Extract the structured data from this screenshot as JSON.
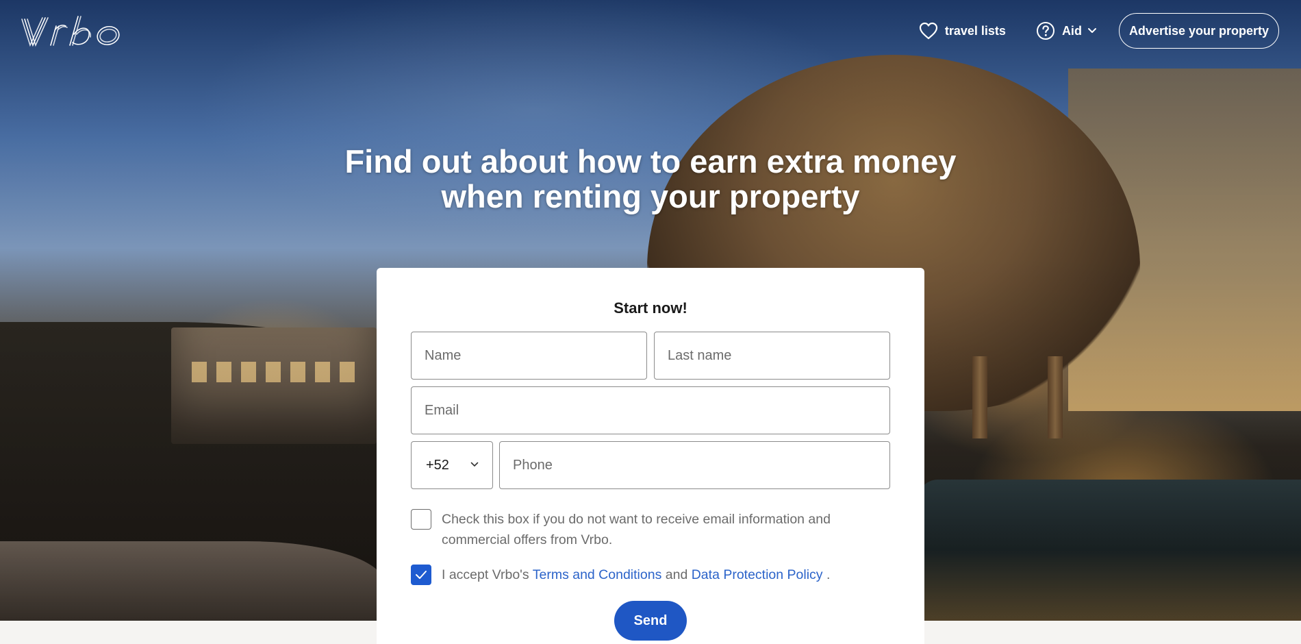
{
  "header": {
    "logo_text": "Vrbo",
    "travel_lists_label": "travel lists",
    "aid_label": "Aid",
    "advertise_label": "Advertise your property"
  },
  "hero": {
    "headline_line1": "Find out about how to earn extra money",
    "headline_line2": "when renting your property"
  },
  "form": {
    "title": "Start now!",
    "name_placeholder": "Name",
    "last_name_placeholder": "Last name",
    "email_placeholder": "Email",
    "country_code": "+52",
    "phone_placeholder": "Phone",
    "optout_checked": false,
    "optout_text": "Check this box if you do not want to receive email information and commercial offers from Vrbo.",
    "accept_checked": true,
    "accept_prefix": "I accept Vrbo's",
    "terms_link": "Terms and Conditions",
    "accept_and": "and",
    "privacy_link": "Data Protection Policy",
    "accept_suffix": ".",
    "send_label": "Send"
  },
  "icons": {
    "travel_lists": "heart-icon",
    "aid": "question-circle-icon",
    "aid_dropdown": "chevron-down-icon",
    "country_dropdown": "chevron-down-icon",
    "accept_check": "checkmark-icon"
  },
  "colors": {
    "primary_button": "#1f57c4",
    "checkbox_checked": "#1e5bd0",
    "link": "#2b63c9",
    "card_background": "#ffffff",
    "page_background": "#f5f4f2"
  }
}
